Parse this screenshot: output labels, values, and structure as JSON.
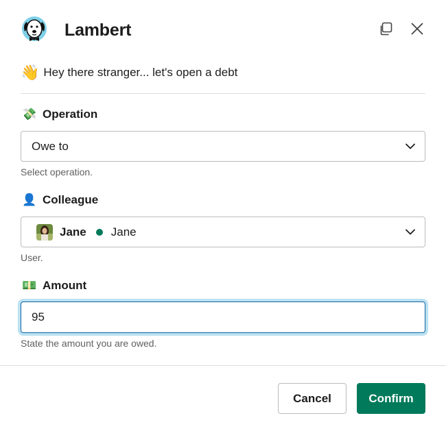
{
  "app": {
    "title": "Lambert",
    "icon": "dog-mascot-icon"
  },
  "header_actions": {
    "open_in_window_icon": "copy-window-icon",
    "close_icon": "close-icon"
  },
  "greeting": {
    "emoji": "👋",
    "text": "Hey there stranger... let's open a debt"
  },
  "operation": {
    "emoji": "💸",
    "label": "Operation",
    "selected": "Owe to",
    "hint": "Select operation."
  },
  "colleague": {
    "emoji": "👤",
    "label": "Colleague",
    "selected_name": "Jane",
    "selected_display": "Jane",
    "presence_color": "#007a5a",
    "hint": "User."
  },
  "amount": {
    "emoji": "💵",
    "label": "Amount",
    "value": "95",
    "hint": "State the amount you are owed."
  },
  "footer": {
    "cancel_label": "Cancel",
    "confirm_label": "Confirm",
    "confirm_color": "#007a5a"
  }
}
